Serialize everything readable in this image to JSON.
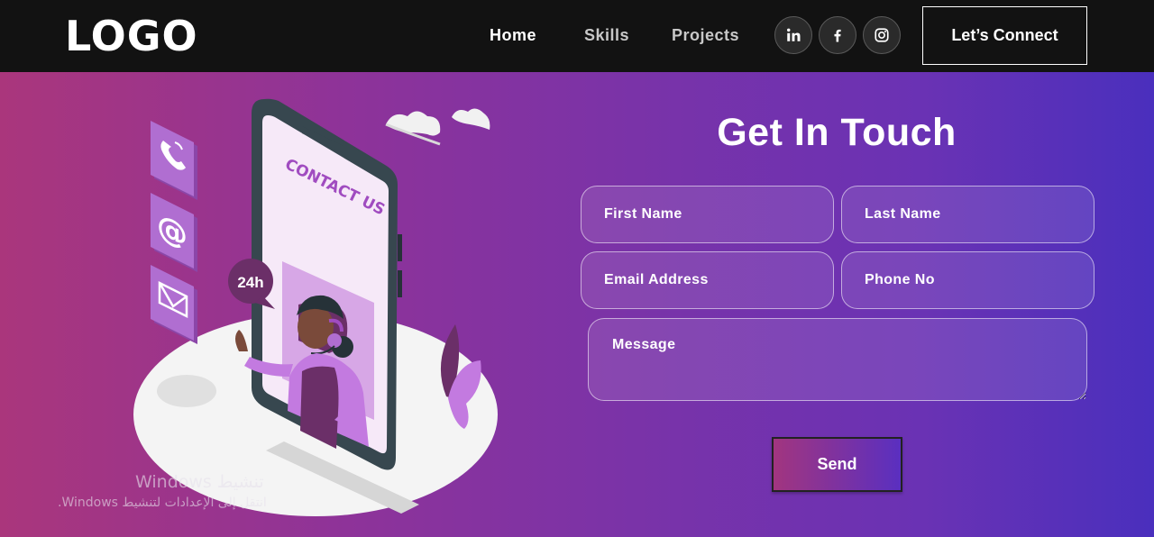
{
  "navbar": {
    "logo": "LOGO",
    "links": [
      {
        "label": "Home"
      },
      {
        "label": "Skills"
      },
      {
        "label": "Projects"
      }
    ],
    "social_icons": [
      "linkedin-icon",
      "facebook-icon",
      "instagram-icon"
    ],
    "connect_label": "Let’s Connect"
  },
  "illustration": {
    "phone_banner": "CONTACT US",
    "bubble_text": "24h",
    "side_icons": [
      "phone-icon",
      "at-sign-icon",
      "mail-icon"
    ]
  },
  "contact": {
    "title": "Get In Touch",
    "fields": {
      "first_name": "First Name",
      "last_name": "Last Name",
      "email": "Email Address",
      "phone": "Phone No",
      "message": "Message"
    },
    "send_label": "Send"
  },
  "watermark": {
    "title": "تنشيط Windows",
    "subtitle": "انتقل إلى الإعدادات لتنشيط Windows."
  },
  "colors": {
    "navbar_bg": "#121212",
    "gradient_start": "#aa367c",
    "gradient_end": "#4a2fbd"
  }
}
